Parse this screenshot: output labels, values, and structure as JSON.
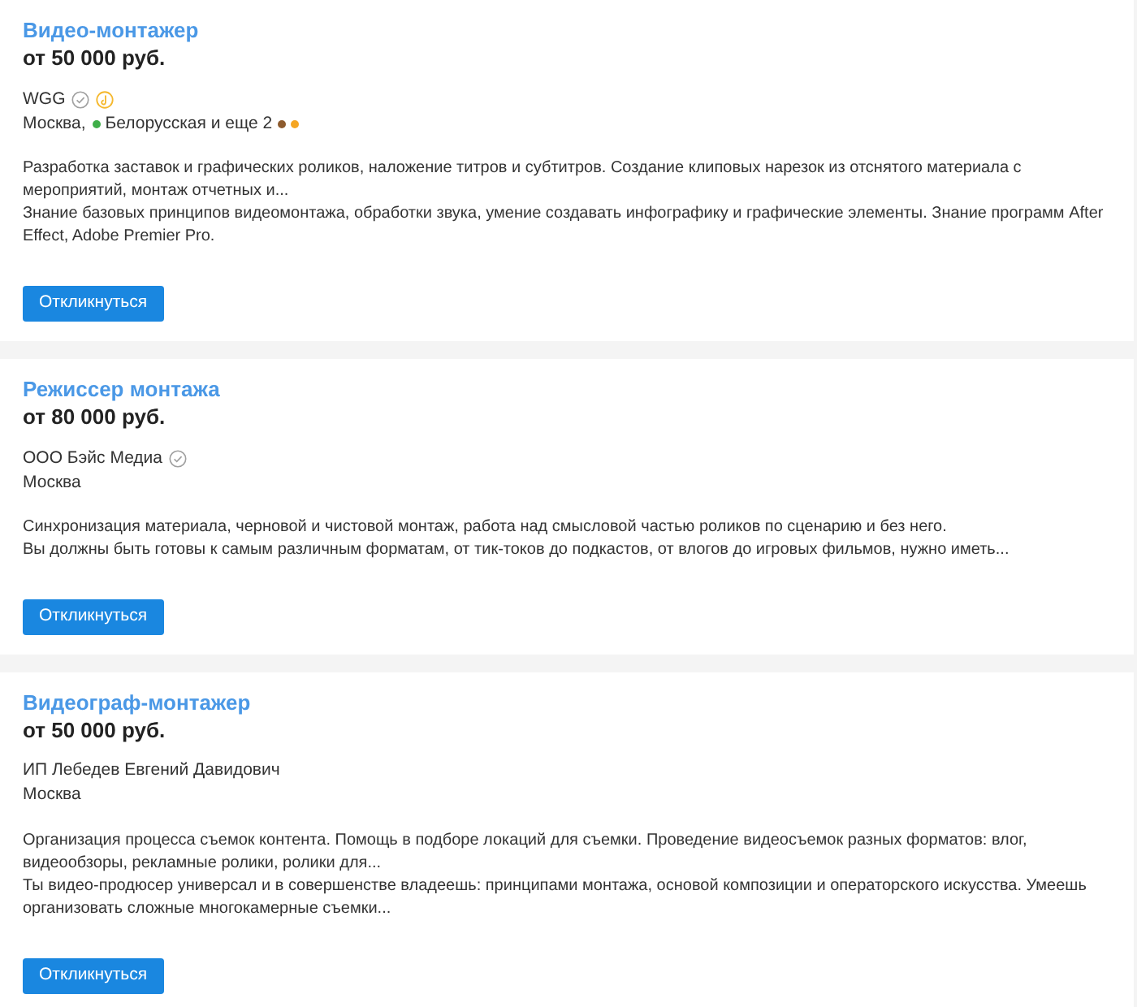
{
  "vacancies": [
    {
      "title": "Видео-монтажер",
      "salary": "от 50 000 руб.",
      "company": "WGG",
      "badges": [
        {
          "kind": "verified"
        },
        {
          "kind": "award"
        }
      ],
      "city": "Москва,",
      "metro": {
        "color": "#3fae49",
        "text": "Белорусская и еще 2"
      },
      "extra_lines": [
        {
          "color": "#8d5b2e"
        },
        {
          "color": "#f5a623"
        }
      ],
      "description": [
        "Разработка заставок и графических роликов, наложение титров и субтитров. Создание клиповых нарезок из отснятого материала с мероприятий, монтаж отчетных и...",
        "Знание базовых принципов видеомонтажа, обработки звука, умение создавать инфографику и графические элементы. Знание программ After Effect, Adobe Premier Pro."
      ],
      "button": "Откликнуться"
    },
    {
      "title": "Режиссер монтажа",
      "salary": "от 80 000 руб.",
      "company": "ООО Бэйс Медиа",
      "badges": [
        {
          "kind": "verified"
        }
      ],
      "city": "Москва",
      "description": [
        "Синхронизация материала, черновой и чистовой монтаж, работа над смысловой частью роликов по сценарию и без него.",
        "Вы должны быть готовы к самым различным форматам, от тик-токов до подкастов, от влогов до игровых фильмов, нужно иметь..."
      ],
      "button": "Откликнуться"
    },
    {
      "title": "Видеограф-монтажер",
      "salary": "от 50 000 руб.",
      "company": "ИП Лебедев Евгений Давидович",
      "city": "Москва",
      "description": [
        "Организация процесса съемок контента. Помощь в подборе локаций для съемки. Проведение видеосъемок разных форматов: влог, видеообзоры, рекламные ролики, ролики для...",
        "Ты видео-продюсер универсал и в совершенстве владеешь: принципами монтажа, основой композиции и операторского искусства. Умеешь организовать сложные многокамерные съемки..."
      ],
      "button": "Откликнуться"
    }
  ]
}
